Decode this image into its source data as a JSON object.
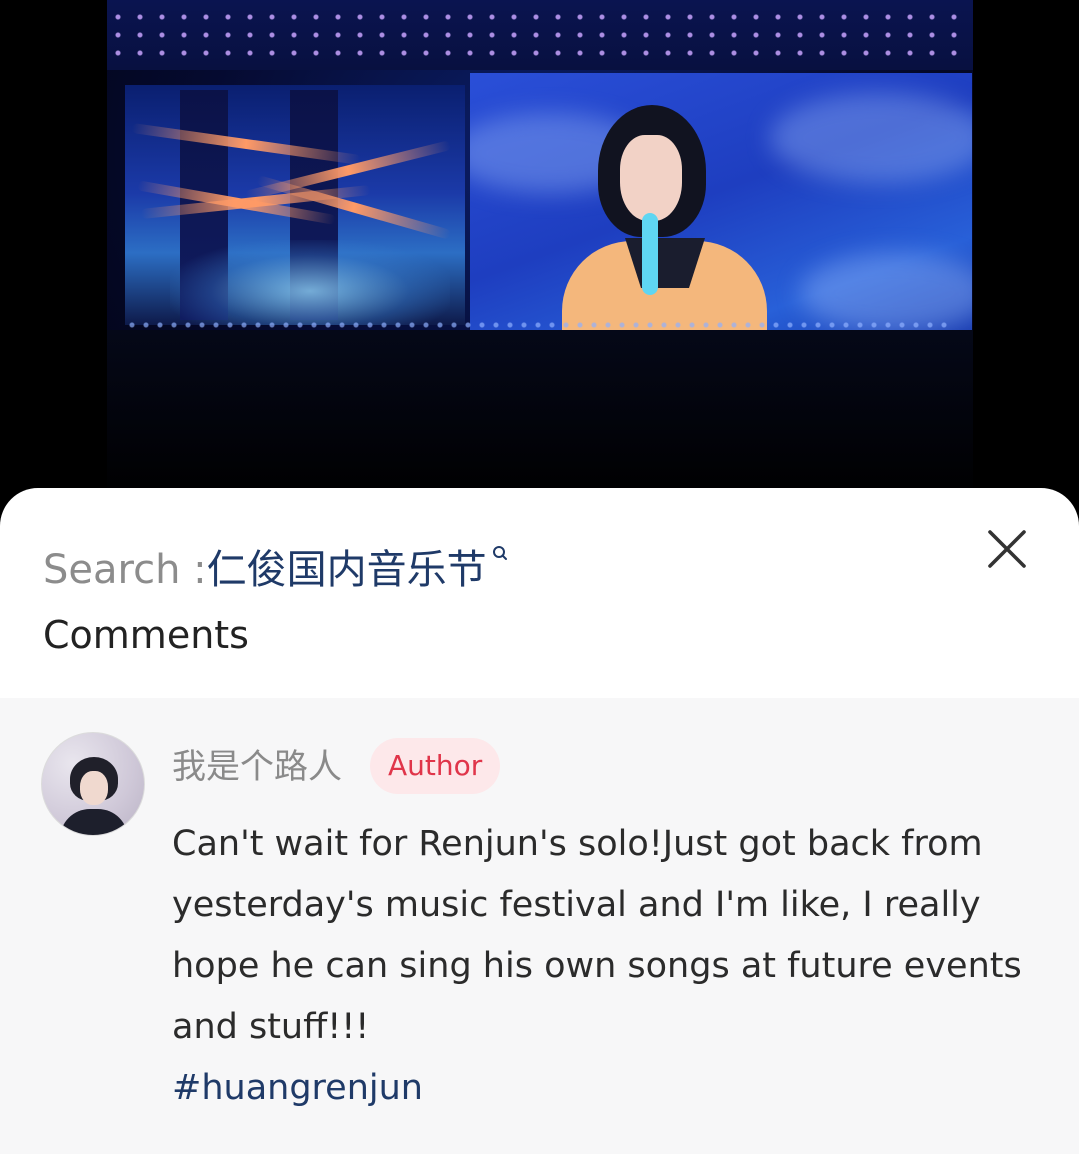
{
  "search": {
    "label": "Search : ",
    "term": "仁俊国内音乐节"
  },
  "sheet": {
    "title": "Comments"
  },
  "comment": {
    "username": "我是个路人",
    "badge": "Author",
    "text": "Can't wait for Renjun's solo!Just got back from yesterday's music festival and I'm like, I really hope he can sing his own songs at future events and stuff!!!",
    "hashtag": "#huangrenjun"
  },
  "icons": {
    "close": "close-icon",
    "search": "search-icon"
  },
  "colors": {
    "accent_text": "#1f3a68",
    "badge_bg": "#fde8ea",
    "badge_text": "#e0354a",
    "muted_text": "#8a8a8a"
  }
}
